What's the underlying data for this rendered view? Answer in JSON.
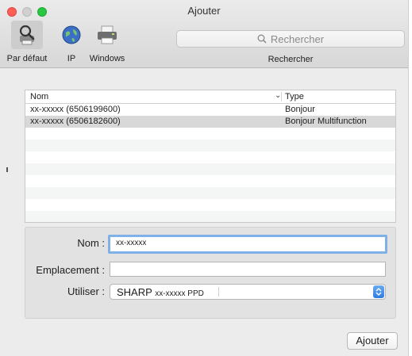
{
  "window": {
    "title": "Ajouter"
  },
  "toolbar": {
    "tabs": [
      {
        "label": "Par défaut",
        "icon": "default-printer-icon",
        "selected": true
      },
      {
        "label": "IP",
        "icon": "globe-icon",
        "selected": false
      },
      {
        "label": "Windows",
        "icon": "windows-printer-icon",
        "selected": false
      }
    ],
    "search": {
      "placeholder": "Rechercher",
      "label": "Rechercher"
    }
  },
  "printer_list": {
    "columns": {
      "name": "Nom",
      "type": "Type"
    },
    "rows": [
      {
        "name": "xx-xxxxx (6506199600)",
        "type": "Bonjour"
      },
      {
        "name": "xx-xxxxx (6506182600)",
        "type": "Bonjour Multifunction"
      }
    ]
  },
  "form": {
    "name_label": "Nom :",
    "name_value": "xx-xxxxx",
    "location_label": "Emplacement :",
    "location_value": "",
    "use_label": "Utiliser :",
    "use_value_brand": "SHARP",
    "use_value_model": "xx-xxxxx PPD"
  },
  "footer": {
    "add_label": "Ajouter"
  },
  "colors": {
    "accent": "#2f7de1",
    "close": "#ff5f57",
    "maximize": "#28c840",
    "focus_ring": "#7fb0e8"
  }
}
